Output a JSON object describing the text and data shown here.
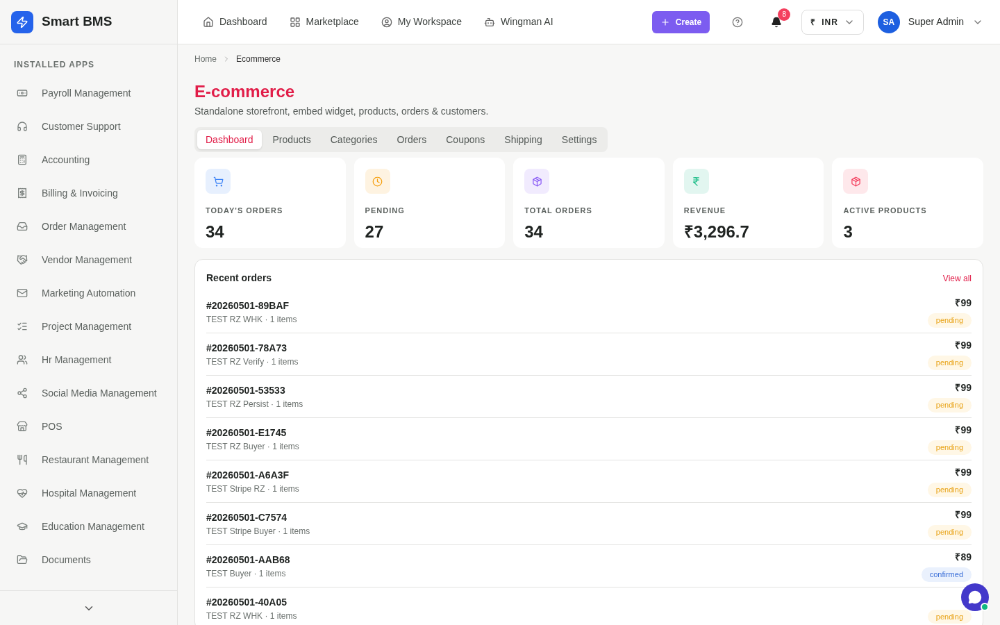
{
  "brand": "Smart BMS",
  "sidebar": {
    "heading": "INSTALLED APPS",
    "items": [
      {
        "label": "Payroll Management"
      },
      {
        "label": "Customer Support"
      },
      {
        "label": "Accounting"
      },
      {
        "label": "Billing & Invoicing"
      },
      {
        "label": "Order Management"
      },
      {
        "label": "Vendor Management"
      },
      {
        "label": "Marketing Automation"
      },
      {
        "label": "Project Management"
      },
      {
        "label": "Hr Management"
      },
      {
        "label": "Social Media Management"
      },
      {
        "label": "POS"
      },
      {
        "label": "Restaurant Management"
      },
      {
        "label": "Hospital Management"
      },
      {
        "label": "Education Management"
      },
      {
        "label": "Documents"
      }
    ]
  },
  "topnav": [
    {
      "label": "Dashboard"
    },
    {
      "label": "Marketplace"
    },
    {
      "label": "My Workspace"
    },
    {
      "label": "Wingman AI"
    }
  ],
  "create_button": "Create",
  "notifications": "8",
  "currency": {
    "symbol": "₹",
    "code": "INR"
  },
  "user": {
    "initials": "SA",
    "name": "Super Admin"
  },
  "breadcrumb": [
    "Home",
    "Ecommerce"
  ],
  "title": "E-commerce",
  "subtitle": "Standalone storefront, embed widget, products, orders & customers.",
  "tabs": [
    {
      "label": "Dashboard",
      "selected": true
    },
    {
      "label": "Products",
      "selected": false
    },
    {
      "label": "Categories",
      "selected": false
    },
    {
      "label": "Orders",
      "selected": false
    },
    {
      "label": "Coupons",
      "selected": false
    },
    {
      "label": "Shipping",
      "selected": false
    },
    {
      "label": "Settings",
      "selected": false
    }
  ],
  "stats": [
    {
      "label": "TODAY'S ORDERS",
      "value": "34",
      "color": "#3b82f6"
    },
    {
      "label": "PENDING",
      "value": "27",
      "color": "#f59e0b"
    },
    {
      "label": "TOTAL ORDERS",
      "value": "34",
      "color": "#8b5cf6"
    },
    {
      "label": "REVENUE",
      "value": "₹3,296.7",
      "color": "#10b981"
    },
    {
      "label": "ACTIVE PRODUCTS",
      "value": "3",
      "color": "#f43f5e"
    }
  ],
  "recent_orders": {
    "title": "Recent orders",
    "view_all": "View all",
    "rows": [
      {
        "id": "#20260501-89BAF",
        "detail": "TEST RZ WHK · 1 items",
        "amount": "₹99",
        "status": "pending",
        "kind": "pending"
      },
      {
        "id": "#20260501-78A73",
        "detail": "TEST RZ Verify · 1 items",
        "amount": "₹99",
        "status": "pending",
        "kind": "pending"
      },
      {
        "id": "#20260501-53533",
        "detail": "TEST RZ Persist · 1 items",
        "amount": "₹99",
        "status": "pending",
        "kind": "pending"
      },
      {
        "id": "#20260501-E1745",
        "detail": "TEST RZ Buyer · 1 items",
        "amount": "₹99",
        "status": "pending",
        "kind": "pending"
      },
      {
        "id": "#20260501-A6A3F",
        "detail": "TEST Stripe RZ · 1 items",
        "amount": "₹99",
        "status": "pending",
        "kind": "pending"
      },
      {
        "id": "#20260501-C7574",
        "detail": "TEST Stripe Buyer · 1 items",
        "amount": "₹99",
        "status": "pending",
        "kind": "pending"
      },
      {
        "id": "#20260501-AAB68",
        "detail": "TEST Buyer · 1 items",
        "amount": "₹89",
        "status": "confirmed",
        "kind": "confirmed"
      },
      {
        "id": "#20260501-40A05",
        "detail": "TEST RZ WHK · 1 items",
        "status": "pending",
        "kind": "pending"
      }
    ]
  }
}
